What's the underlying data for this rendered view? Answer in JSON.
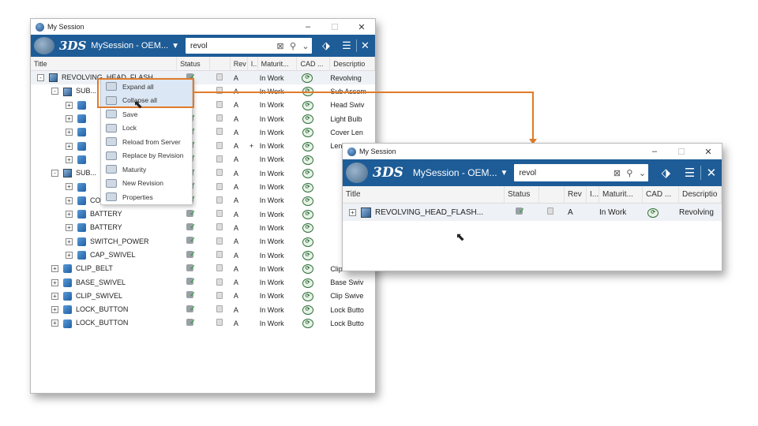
{
  "main_window": {
    "title": "My Session",
    "controls": [
      "–",
      "☐",
      "✕"
    ],
    "toolbar": {
      "logo": "3DS",
      "session": "MySession - OEM...",
      "search_value": "revol"
    },
    "columns": [
      "Title",
      "Status",
      "",
      "Rev",
      "I...",
      "Maturit...",
      "CAD ...",
      "Descriptio"
    ],
    "rows": [
      {
        "indent": 0,
        "expander": "-",
        "icon": "assembly",
        "title": "REVOLVING_HEAD_FLASH...",
        "rev": "A",
        "i": "",
        "maturity": "In Work",
        "desc": "Revolving"
      },
      {
        "indent": 1,
        "expander": "-",
        "icon": "assembly",
        "title": "SUB...",
        "rev": "A",
        "i": "",
        "maturity": "In Work",
        "desc": "Sub Assem"
      },
      {
        "indent": 2,
        "expander": "+",
        "icon": "part",
        "title": "",
        "rev": "A",
        "i": "",
        "maturity": "In Work",
        "desc": "Head Swiv"
      },
      {
        "indent": 2,
        "expander": "+",
        "icon": "part",
        "title": "",
        "rev": "A",
        "i": "",
        "maturity": "In Work",
        "desc": "Light Bulb"
      },
      {
        "indent": 2,
        "expander": "+",
        "icon": "part",
        "title": "",
        "rev": "A",
        "i": "",
        "maturity": "In Work",
        "desc": "Cover Len"
      },
      {
        "indent": 2,
        "expander": "+",
        "icon": "part",
        "title": "",
        "rev": "A",
        "i": "+",
        "maturity": "In Work",
        "desc": "Lens"
      },
      {
        "indent": 2,
        "expander": "+",
        "icon": "part",
        "title": "",
        "rev": "A",
        "i": "",
        "maturity": "In Work",
        "desc": ""
      },
      {
        "indent": 1,
        "expander": "-",
        "icon": "assembly",
        "title": "SUB...",
        "rev": "A",
        "i": "",
        "maturity": "In Work",
        "desc": ""
      },
      {
        "indent": 2,
        "expander": "+",
        "icon": "part",
        "title": "",
        "rev": "A",
        "i": "",
        "maturity": "In Work",
        "desc": ""
      },
      {
        "indent": 2,
        "expander": "+",
        "icon": "part",
        "title": "COVER_BATTERY",
        "rev": "A",
        "i": "",
        "maturity": "In Work",
        "desc": ""
      },
      {
        "indent": 2,
        "expander": "+",
        "icon": "part",
        "title": "BATTERY",
        "rev": "A",
        "i": "",
        "maturity": "In Work",
        "desc": ""
      },
      {
        "indent": 2,
        "expander": "+",
        "icon": "part",
        "title": "BATTERY",
        "rev": "A",
        "i": "",
        "maturity": "In Work",
        "desc": ""
      },
      {
        "indent": 2,
        "expander": "+",
        "icon": "part",
        "title": "SWITCH_POWER",
        "rev": "A",
        "i": "",
        "maturity": "In Work",
        "desc": ""
      },
      {
        "indent": 2,
        "expander": "+",
        "icon": "part",
        "title": "CAP_SWIVEL",
        "rev": "A",
        "i": "",
        "maturity": "In Work",
        "desc": ""
      },
      {
        "indent": 1,
        "expander": "+",
        "icon": "part",
        "title": "CLIP_BELT",
        "rev": "A",
        "i": "",
        "maturity": "In Work",
        "desc": "Clip Belt"
      },
      {
        "indent": 1,
        "expander": "+",
        "icon": "part",
        "title": "BASE_SWIVEL",
        "rev": "A",
        "i": "",
        "maturity": "In Work",
        "desc": "Base Swiv"
      },
      {
        "indent": 1,
        "expander": "+",
        "icon": "part",
        "title": "CLIP_SWIVEL",
        "rev": "A",
        "i": "",
        "maturity": "In Work",
        "desc": "Clip Swive"
      },
      {
        "indent": 1,
        "expander": "+",
        "icon": "part",
        "title": "LOCK_BUTTON",
        "rev": "A",
        "i": "",
        "maturity": "In Work",
        "desc": "Lock Butto"
      },
      {
        "indent": 1,
        "expander": "+",
        "icon": "part",
        "title": "LOCK_BUTTON",
        "rev": "A",
        "i": "",
        "maturity": "In Work",
        "desc": "Lock Butto"
      }
    ]
  },
  "context_menu": {
    "items": [
      {
        "label": "Expand all",
        "icon": "expand-tree-icon"
      },
      {
        "label": "Collapse all",
        "icon": "collapse-tree-icon"
      },
      {
        "label": "Save",
        "icon": "save-icon"
      },
      {
        "label": "Lock",
        "icon": "lock-icon"
      },
      {
        "label": "Reload from Server",
        "icon": "reload-icon"
      },
      {
        "label": "Replace by Revision",
        "icon": "replace-icon"
      },
      {
        "label": "Maturity",
        "icon": "maturity-icon"
      },
      {
        "label": "New Revision",
        "icon": "new-revision-icon"
      },
      {
        "label": "Properties",
        "icon": "properties-icon"
      }
    ],
    "highlight_color": "#e07b2b"
  },
  "result_window": {
    "title": "My Session",
    "controls": [
      "–",
      "☐",
      "✕"
    ],
    "toolbar": {
      "logo": "3DS",
      "session": "MySession - OEM...",
      "search_value": "revol"
    },
    "columns": [
      "Title",
      "Status",
      "",
      "Rev",
      "I...",
      "Maturit...",
      "CAD ...",
      "Descriptio"
    ],
    "rows": [
      {
        "expander": "+",
        "title": "REVOLVING_HEAD_FLASH...",
        "rev": "A",
        "maturity": "In Work",
        "desc": "Revolving"
      }
    ]
  }
}
